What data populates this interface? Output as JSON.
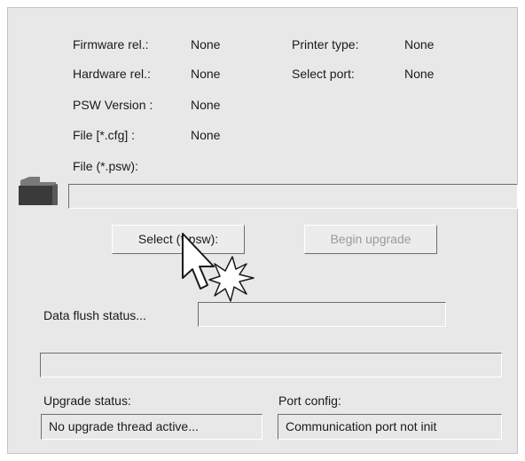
{
  "info": {
    "firmware_label": "Firmware rel.:",
    "firmware_value": "None",
    "hardware_label": "Hardware rel.:",
    "hardware_value": "None",
    "psw_label": "PSW Version :",
    "psw_value": "None",
    "cfg_label": "File [*.cfg] :",
    "cfg_value": "None",
    "printer_type_label": "Printer type:",
    "printer_type_value": "None",
    "select_port_label": "Select port:",
    "select_port_value": "None"
  },
  "psw_file": {
    "label": "File (*.psw):",
    "value": "",
    "icon": "folder-icon"
  },
  "buttons": {
    "select_label": "Select (*.psw):",
    "upgrade_label": "Begin upgrade"
  },
  "flush": {
    "label": "Data flush status...",
    "value": ""
  },
  "progress": {
    "value": ""
  },
  "upgrade_status": {
    "label": "Upgrade status:",
    "value": "No upgrade thread active..."
  },
  "port_config": {
    "label": "Port config:",
    "value": "Communication port not init"
  },
  "overlay": {
    "cursor_icon": "pointer-cursor-icon",
    "click_icon": "click-burst-icon"
  }
}
